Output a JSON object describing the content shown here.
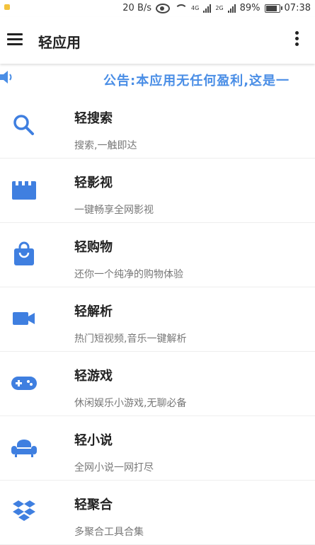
{
  "status_bar": {
    "net_speed": "20 B/s",
    "sim1": "4G",
    "sim2": "2G",
    "battery": "89%",
    "battery_level": 0.89,
    "time": "07:38"
  },
  "app_bar": {
    "title": "轻应用",
    "menu_icon": "hamburger-menu-icon",
    "more_icon": "more-vert-icon"
  },
  "notice": {
    "icon": "speaker-icon",
    "text": "公告:本应用无任何盈利,这是一"
  },
  "accent_color": "#3f7fe0",
  "items": [
    {
      "icon": "search-icon",
      "name": "轻搜索",
      "desc": "搜索,一触即达"
    },
    {
      "icon": "movie-clapper-icon",
      "name": "轻影视",
      "desc": "一键畅享全网影视"
    },
    {
      "icon": "shopping-bag-icon",
      "name": "轻购物",
      "desc": "还你一个纯净的购物体验"
    },
    {
      "icon": "video-camera-icon",
      "name": "轻解析",
      "desc": "热门短视频,音乐一键解析"
    },
    {
      "icon": "gamepad-icon",
      "name": "轻游戏",
      "desc": "休闲娱乐小游戏,无聊必备"
    },
    {
      "icon": "sofa-icon",
      "name": "轻小说",
      "desc": "全网小说一网打尽"
    },
    {
      "icon": "dropbox-icon",
      "name": "轻聚合",
      "desc": "多聚合工具合集"
    }
  ]
}
